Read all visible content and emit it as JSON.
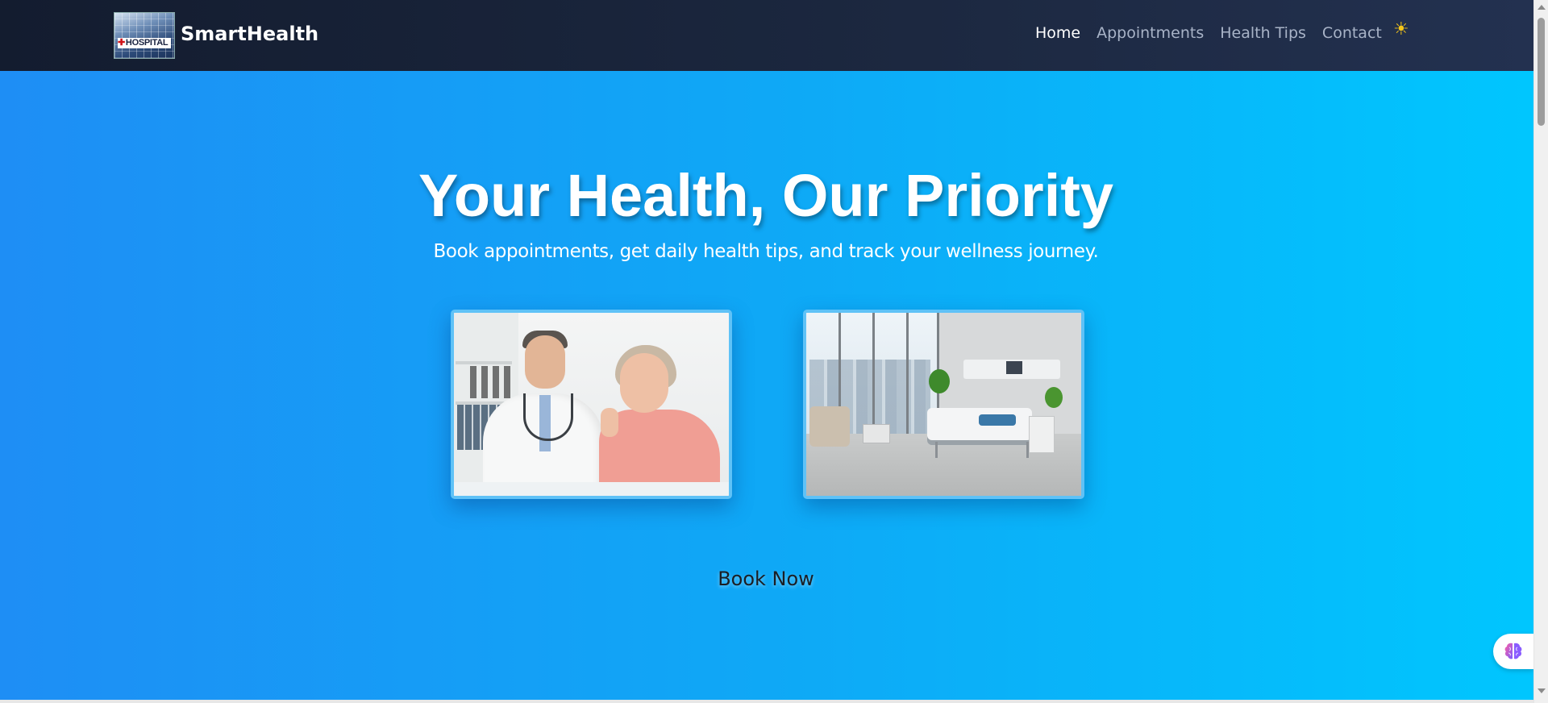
{
  "navbar": {
    "brand_name": "SmartHealth",
    "logo_sign_text": "HOSPITAL",
    "links": [
      {
        "label": "Home",
        "active": true
      },
      {
        "label": "Appointments",
        "active": false
      },
      {
        "label": "Health Tips",
        "active": false
      },
      {
        "label": "Contact",
        "active": false
      }
    ],
    "theme_toggle_icon": "sun-icon",
    "theme_toggle_glyph": "☀"
  },
  "hero": {
    "title": "Your Health, Our Priority",
    "subtitle": "Book appointments, get daily health tips, and track your wellness journey.",
    "images": [
      {
        "name": "doctor-with-patient-photo"
      },
      {
        "name": "hospital-room-photo"
      }
    ],
    "cta_label": "Book Now"
  },
  "floating_button": {
    "icon": "brain-icon"
  },
  "colors": {
    "navbar_bg": "#1c2840",
    "hero_gradient_start": "#1e8ef5",
    "hero_gradient_end": "#00c6fe",
    "photo_border": "#5fc2f7",
    "nav_active": "#ffffff",
    "nav_inactive": "#a8b3c7",
    "sun": "#f5c518"
  }
}
